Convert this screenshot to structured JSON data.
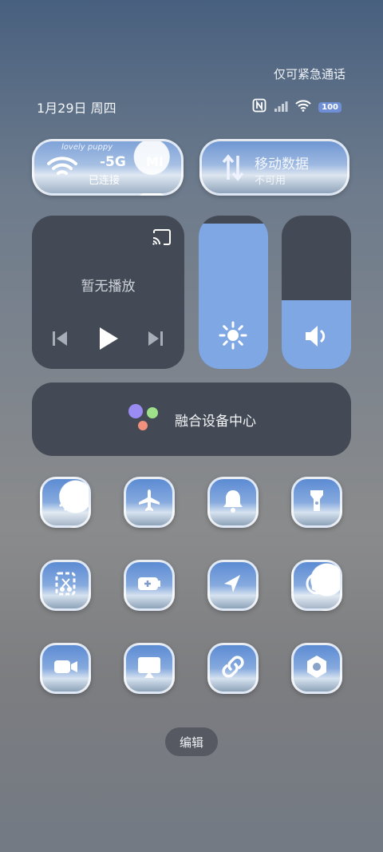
{
  "status": {
    "emergency": "仅可紧急通话",
    "date": "1月29日 周四",
    "battery": "100"
  },
  "wifi_tile": {
    "title": "-5G",
    "sub": "已连接",
    "brand": "MI",
    "deco": "lovely puppy"
  },
  "data_tile": {
    "title": "移动数据",
    "sub": "不可用"
  },
  "media": {
    "text": "暂无播放"
  },
  "sliders": {
    "brightness": 0.95,
    "volume": 0.45
  },
  "device_center": {
    "label": "融合设备中心"
  },
  "toggles": [
    {
      "name": "bluetooth-icon",
      "on": true
    },
    {
      "name": "airplane-icon",
      "on": false
    },
    {
      "name": "bell-icon",
      "on": false
    },
    {
      "name": "flashlight-icon",
      "on": false
    },
    {
      "name": "screenshot-icon",
      "on": false
    },
    {
      "name": "battery-saver-icon",
      "on": false
    },
    {
      "name": "location-icon",
      "on": false
    },
    {
      "name": "rotation-lock-icon",
      "on": true
    },
    {
      "name": "screen-record-icon",
      "on": false
    },
    {
      "name": "cast-screen-icon",
      "on": false
    },
    {
      "name": "link-icon",
      "on": false
    },
    {
      "name": "settings-icon",
      "on": false
    }
  ],
  "edit": "编辑"
}
